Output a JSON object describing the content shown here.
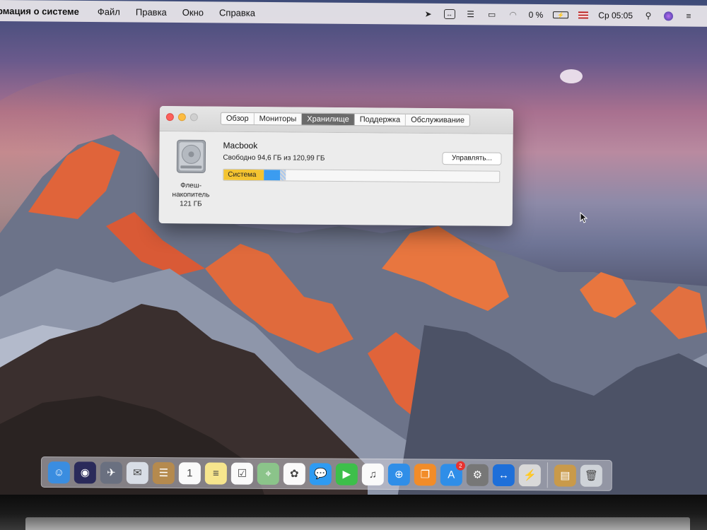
{
  "menubar": {
    "app_name": "рмация о системе",
    "menus": [
      "Файл",
      "Правка",
      "Окно",
      "Справка"
    ],
    "battery": "0 %",
    "clock": "Ср 05:05",
    "icons": [
      "location-arrow-icon",
      "teamviewer-icon",
      "network-drive-icon",
      "airplay-icon",
      "wifi-icon",
      "battery-icon",
      "keyboard-flag-icon",
      "search-icon",
      "siri-icon",
      "list-icon"
    ]
  },
  "window": {
    "tabs": [
      {
        "label": "Обзор",
        "active": false
      },
      {
        "label": "Мониторы",
        "active": false
      },
      {
        "label": "Хранилище",
        "active": true
      },
      {
        "label": "Поддержка",
        "active": false
      },
      {
        "label": "Обслуживание",
        "active": false
      }
    ],
    "disk": {
      "caption_line1": "Флеш-",
      "caption_line2": "накопитель",
      "caption_line3": "121 ГБ",
      "volume_name": "Macbook",
      "free_text": "Свободно 94,6 ГБ из 120,99 ГБ",
      "manage_label": "Управлять...",
      "usage": [
        {
          "label": "Система",
          "fraction": 0.145,
          "color": "#f4c430"
        },
        {
          "label": "",
          "fraction": 0.06,
          "color": "#3b9cf0"
        },
        {
          "label": "",
          "fraction": 0.02,
          "color": "#a8c8f0"
        }
      ]
    }
  },
  "dock": {
    "apps": [
      {
        "name": "finder-icon",
        "color": "#3a8de0",
        "glyph": "☺"
      },
      {
        "name": "siri-icon",
        "color": "#2a2a5a",
        "glyph": "◉"
      },
      {
        "name": "launchpad-icon",
        "color": "#6a7080",
        "glyph": "✈"
      },
      {
        "name": "mail-icon",
        "color": "#d8dde6",
        "glyph": "✉"
      },
      {
        "name": "contacts-icon",
        "color": "#b58a4e",
        "glyph": "☰"
      },
      {
        "name": "calendar-icon",
        "color": "#fafafa",
        "glyph": "1"
      },
      {
        "name": "notes-icon",
        "color": "#f6e58d",
        "glyph": "≡"
      },
      {
        "name": "reminders-icon",
        "color": "#fafafa",
        "glyph": "☑"
      },
      {
        "name": "maps-icon",
        "color": "#8bc48a",
        "glyph": "⌖"
      },
      {
        "name": "photos-icon",
        "color": "#fafafa",
        "glyph": "✿"
      },
      {
        "name": "messages-icon",
        "color": "#2e9bf2",
        "glyph": "💬"
      },
      {
        "name": "facetime-icon",
        "color": "#3dbf4a",
        "glyph": "▶"
      },
      {
        "name": "itunes-icon",
        "color": "#fafafa",
        "glyph": "♫"
      },
      {
        "name": "safari-icon",
        "color": "#2f8ee8",
        "glyph": "⊕"
      },
      {
        "name": "ibooks-icon",
        "color": "#f28c28",
        "glyph": "❐"
      },
      {
        "name": "app-store-icon",
        "color": "#2f8ee8",
        "glyph": "A",
        "badge": "2"
      },
      {
        "name": "system-preferences-icon",
        "color": "#777777",
        "glyph": "⚙"
      },
      {
        "name": "teamviewer-icon",
        "color": "#1e6fd9",
        "glyph": "↔"
      },
      {
        "name": "system-information-icon",
        "color": "#d9d9d9",
        "glyph": "⚡"
      }
    ],
    "trailing": [
      {
        "name": "downloads-stack-icon",
        "color": "#c99a4a",
        "glyph": "▤"
      },
      {
        "name": "trash-icon",
        "color": "#cfd3d8",
        "glyph": "🗑"
      }
    ]
  }
}
